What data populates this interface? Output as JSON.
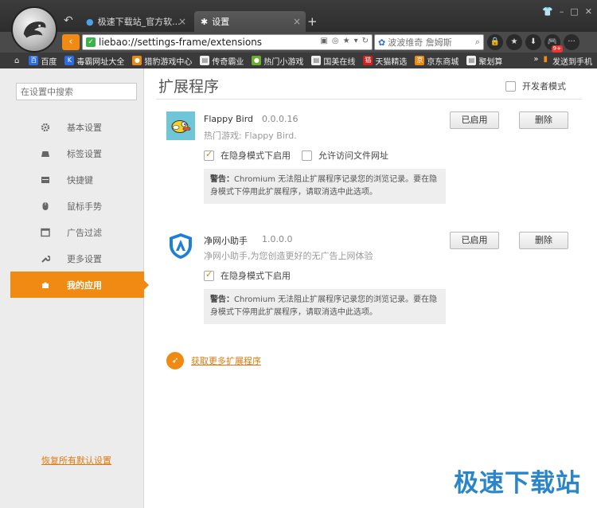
{
  "tabs": [
    {
      "label": "极速下载站_官方软...",
      "icon": "globe-icon"
    },
    {
      "label": "设置",
      "icon": "gear-icon"
    }
  ],
  "window_controls": [
    "shirt-icon",
    "minimize-icon",
    "maximize-icon",
    "close-icon"
  ],
  "address": {
    "url": "liebao://settings-frame/extensions",
    "search_placeholder": "波波维奇 詹姆斯"
  },
  "bookmarks": [
    {
      "label": "百度",
      "icon": "baidu-icon",
      "color": "#2b6de0"
    },
    {
      "label": "毒霸网址大全",
      "icon": "duba-icon",
      "color": "#2b6de0"
    },
    {
      "label": "猎豹游戏中心",
      "icon": "game-icon",
      "color": "#e98a12"
    },
    {
      "label": "传奇霸业",
      "icon": "page-icon",
      "color": "#ffffff"
    },
    {
      "label": "热门小游戏",
      "icon": "smallgame-icon",
      "color": "#6ab02c"
    },
    {
      "label": "国美在线",
      "icon": "page-icon",
      "color": "#ffffff"
    },
    {
      "label": "天猫精选",
      "icon": "tmall-icon",
      "color": "#d02020"
    },
    {
      "label": "京东商城",
      "icon": "jd-icon",
      "color": "#e98a12"
    },
    {
      "label": "聚划算",
      "icon": "page-icon",
      "color": "#ffffff"
    }
  ],
  "send_to_phone": "发送到手机",
  "sidebar": {
    "search_placeholder": "在设置中搜索",
    "items": [
      {
        "label": "基本设置",
        "icon": "gear-icon"
      },
      {
        "label": "标签设置",
        "icon": "tab-icon"
      },
      {
        "label": "快捷键",
        "icon": "keyboard-icon"
      },
      {
        "label": "鼠标手势",
        "icon": "mouse-icon"
      },
      {
        "label": "广告过滤",
        "icon": "window-icon"
      },
      {
        "label": "更多设置",
        "icon": "wrench-icon"
      },
      {
        "label": "我的应用",
        "icon": "puzzle-icon"
      }
    ],
    "active_index": 6,
    "restore_label": "恢复所有默认设置"
  },
  "main": {
    "title": "扩展程序",
    "dev_mode_label": "开发者模式",
    "extensions": [
      {
        "name": "Flappy Bird",
        "version": "0.0.0.16",
        "description": "热门游戏: Flappy Bird.",
        "options": [
          {
            "label": "在隐身模式下启用",
            "checked": true
          },
          {
            "label": "允许访问文件网址",
            "checked": false
          }
        ],
        "warning_title": "警告：",
        "warning_text": "Chromium 无法阻止扩展程序记录您的浏览记录。要在隐身模式下停用此扩展程序，请取消选中此选项。",
        "enabled_label": "已启用",
        "delete_label": "删除"
      },
      {
        "name": "净网小助手",
        "version": "1.0.0.0",
        "description": "净网小助手,为您创造更好的无广告上网体验",
        "options": [
          {
            "label": "在隐身模式下启用",
            "checked": true
          }
        ],
        "warning_title": "警告：",
        "warning_text": "Chromium 无法阻止扩展程序记录您的浏览记录。要在隐身模式下停用此扩展程序，请取消选中此选项。",
        "enabled_label": "已启用",
        "delete_label": "删除"
      }
    ],
    "more_link": "获取更多扩展程序"
  },
  "watermark": "极速下载站",
  "colors": {
    "accent": "#f08a12",
    "link": "#e07a10",
    "watermark": "#2a86c8"
  }
}
